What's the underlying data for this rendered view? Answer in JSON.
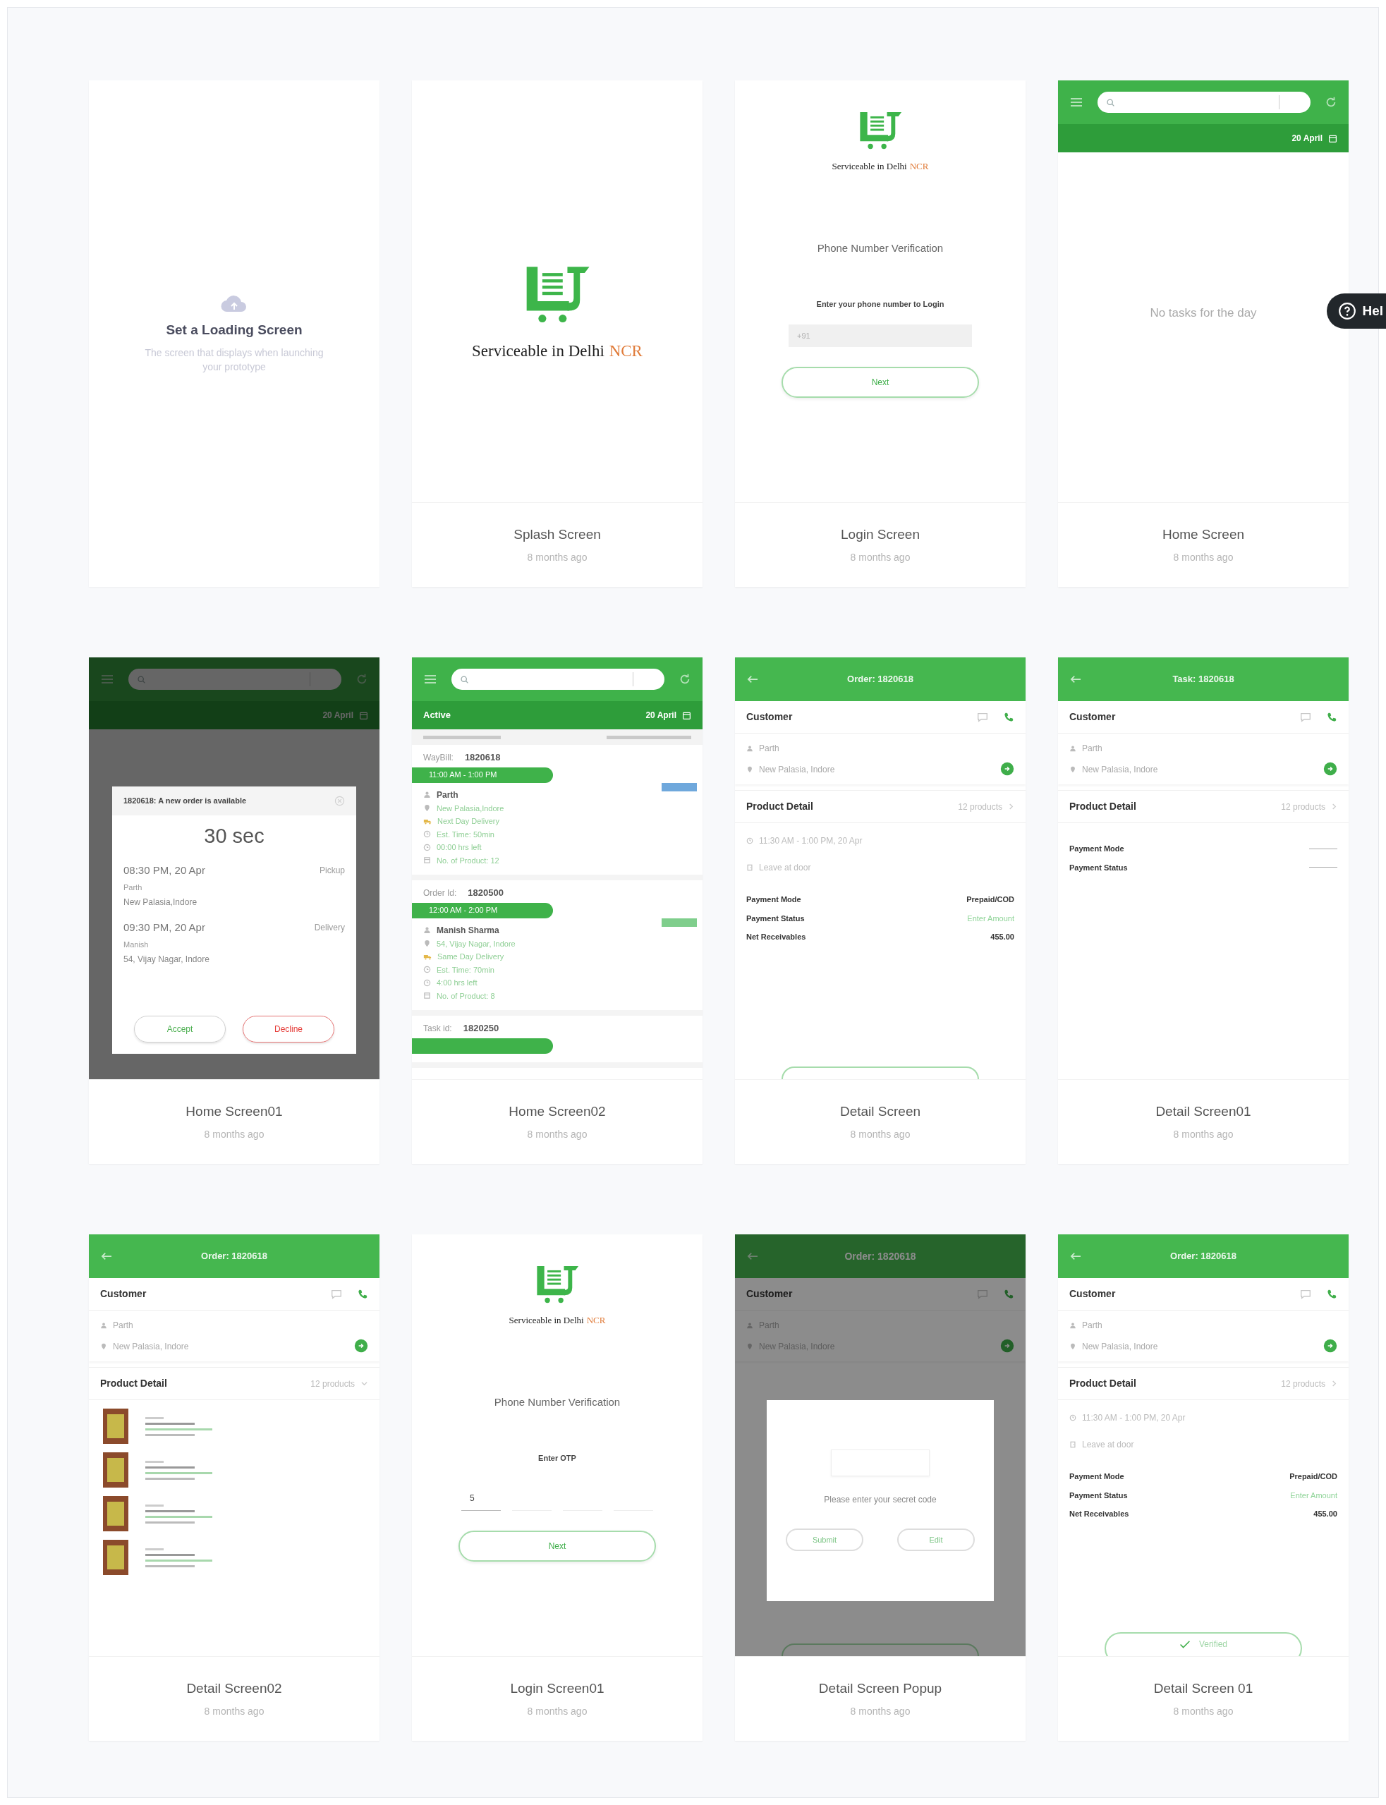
{
  "help_button": {
    "label": "Hel"
  },
  "screens": [
    {
      "kind": "loading",
      "heading": "Set a Loading Screen",
      "description": "The screen that displays when launching your prototype"
    },
    {
      "kind": "splash",
      "title": "Splash Screen",
      "time": "8 months ago",
      "tagline": "Serviceable in Delhi",
      "tagline_accent": "NCR"
    },
    {
      "kind": "login",
      "title": "Login Screen",
      "time": "8 months ago",
      "tagline": "Serviceable in Delhi",
      "tagline_accent": "NCR",
      "heading": "Phone Number Verification",
      "prompt": "Enter your phone number to Login",
      "field": {
        "placeholder": "+91"
      },
      "button": "Next"
    },
    {
      "kind": "home_empty",
      "title": "Home Screen",
      "time": "8 months ago",
      "date": "20 April",
      "message": "No tasks for the day"
    },
    {
      "kind": "home_popup",
      "title": "Home Screen01",
      "time": "8 months ago",
      "date": "20 April",
      "popup": {
        "heading": "1820618: A new order is available",
        "countdown": "30 sec",
        "stops": [
          {
            "time": "08:30 PM, 20 Apr",
            "type": "Pickup",
            "name": "Parth",
            "address": "New Palasia,Indore"
          },
          {
            "time": "09:30 PM, 20 Apr",
            "type": "Delivery",
            "name": "Manish",
            "address": "54, Vijay Nagar, Indore"
          }
        ],
        "accept": "Accept",
        "decline": "Decline"
      }
    },
    {
      "kind": "home_list",
      "title": "Home Screen02",
      "time": "8 months ago",
      "tab": "Active",
      "date": "20 April",
      "entries": [
        {
          "id_label": "WayBill:",
          "id": "1820618",
          "slot": "11:00 AM - 1:00 PM",
          "color": "#6fa8dc",
          "lines": [
            {
              "kind": "name",
              "text": "Parth"
            },
            {
              "kind": "address",
              "text": "New Palasia,Indore"
            },
            {
              "kind": "delivery",
              "text": "Next Day Delivery"
            },
            {
              "kind": "time",
              "text": "Est. Time: 50min"
            },
            {
              "kind": "time",
              "text": "00:00 hrs left"
            },
            {
              "kind": "count",
              "text": "No. of Product: 12"
            }
          ]
        },
        {
          "id_label": "Order Id:",
          "id": "1820500",
          "slot": "12:00 AM - 2:00 PM",
          "color": "#7fce8c",
          "lines": [
            {
              "kind": "name",
              "text": "Manish Sharma"
            },
            {
              "kind": "address",
              "text": "54, Vijay Nagar, Indore"
            },
            {
              "kind": "delivery",
              "text": "Same Day Delivery"
            },
            {
              "kind": "time",
              "text": "Est. Time: 70min"
            },
            {
              "kind": "time",
              "text": "4:00 hrs left"
            },
            {
              "kind": "count",
              "text": "No. of Product: 8"
            }
          ]
        },
        {
          "id_label": "Task id:",
          "id": "1820250"
        }
      ]
    },
    {
      "kind": "detail",
      "title": "Detail Screen",
      "time": "8 months ago",
      "header": "Order: 1820618",
      "customer_label": "Customer",
      "customer_name": "Parth",
      "address": "New Palasia, Indore",
      "product_label": "Product Detail",
      "product_count": "12 products",
      "product_expanded": false,
      "slot": "11:30 AM - 1:00 PM, 20 Apr",
      "instruction": "Leave at door",
      "payments": [
        {
          "kind": "plain",
          "label": "Payment Mode",
          "value": "Prepaid/COD"
        },
        {
          "kind": "link",
          "label": "Payment Status",
          "value": "Enter Amount"
        },
        {
          "kind": "plain",
          "label": "Net Receivables",
          "value": "455.00"
        }
      ],
      "footer_button": {
        "kind": "cut"
      }
    },
    {
      "kind": "detail",
      "title": "Detail Screen01",
      "time": "8 months ago",
      "header": "Task: 1820618",
      "customer_label": "Customer",
      "customer_name": "Parth",
      "address": "New Palasia, Indore",
      "product_label": "Product Detail",
      "product_count": "12 products",
      "product_expanded": false,
      "payments": [
        {
          "kind": "blank",
          "label": "Payment Mode"
        },
        {
          "kind": "blank",
          "label": "Payment Status"
        }
      ]
    },
    {
      "kind": "detail",
      "title": "Detail Screen02",
      "time": "8 months ago",
      "header": "Order: 1820618",
      "customer_label": "Customer",
      "customer_name": "Parth",
      "address": "New Palasia, Indore",
      "product_label": "Product Detail",
      "product_count": "12 products",
      "product_expanded": true,
      "products": [
        {
          "kind": "item"
        },
        {
          "kind": "item"
        },
        {
          "kind": "item"
        },
        {
          "kind": "item"
        }
      ]
    },
    {
      "kind": "login",
      "title": "Login Screen01",
      "time": "8 months ago",
      "tagline": "Serviceable in Delhi",
      "tagline_accent": "NCR",
      "heading": "Phone Number Verification",
      "prompt": "Enter OTP",
      "otp_boxes": [
        {
          "filled": true,
          "value": "5"
        },
        {
          "filled": false
        },
        {
          "filled": false
        },
        {
          "filled": false
        }
      ],
      "button": "Next"
    },
    {
      "kind": "detail",
      "title": "Detail Screen Popup",
      "time": "8 months ago",
      "header": "Order: 1820618",
      "customer_label": "Customer",
      "customer_name": "Parth",
      "address": "New Palasia, Indore",
      "footer_button": {
        "kind": "cut"
      },
      "popup": {
        "message": "Please enter your secret code",
        "submit": "Submit",
        "edit": "Edit"
      }
    },
    {
      "kind": "detail",
      "title": "Detail Screen 01",
      "time": "8 months ago",
      "header": "Order: 1820618",
      "customer_label": "Customer",
      "customer_name": "Parth",
      "address": "New Palasia, Indore",
      "product_label": "Product Detail",
      "product_count": "12 products",
      "product_expanded": false,
      "slot": "11:30 AM - 1:00 PM, 20 Apr",
      "instruction": "Leave at door",
      "payments": [
        {
          "kind": "plain",
          "label": "Payment Mode",
          "value": "Prepaid/COD"
        },
        {
          "kind": "link",
          "label": "Payment Status",
          "value": "Enter Amount"
        },
        {
          "kind": "plain",
          "label": "Net Receivables",
          "value": "455.00"
        }
      ],
      "footer_button": {
        "kind": "verified",
        "label": "Verified"
      }
    }
  ]
}
